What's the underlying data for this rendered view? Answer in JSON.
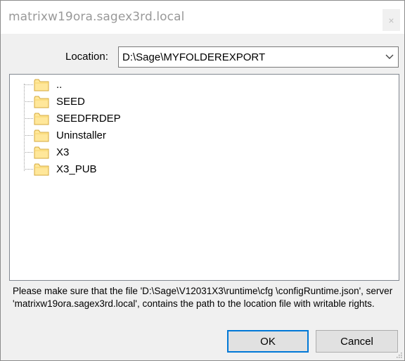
{
  "window": {
    "title": "matrixw19ora.sagex3rd.local",
    "close_glyph": "×"
  },
  "location": {
    "label": "Location:",
    "value": "D:\\Sage\\MYFOLDEREXPORT"
  },
  "tree": {
    "items": [
      {
        "label": ".."
      },
      {
        "label": "SEED"
      },
      {
        "label": "SEEDFRDEP"
      },
      {
        "label": "Uninstaller"
      },
      {
        "label": "X3"
      },
      {
        "label": "X3_PUB"
      }
    ]
  },
  "message": {
    "text": "Please make sure that the file 'D:\\Sage\\V12031X3\\runtime\\cfg \\configRuntime.json', server 'matrixw19ora.sagex3rd.local', contains the path to the location file with writable rights."
  },
  "buttons": {
    "ok_label": "OK",
    "cancel_label": "Cancel"
  },
  "colors": {
    "accent": "#0078d7",
    "folder_fill": "#ffe79a",
    "folder_stroke": "#d4a93c"
  },
  "icons": {
    "folder": "folder-icon",
    "dropdown": "chevron-down-icon",
    "close": "close-icon"
  }
}
